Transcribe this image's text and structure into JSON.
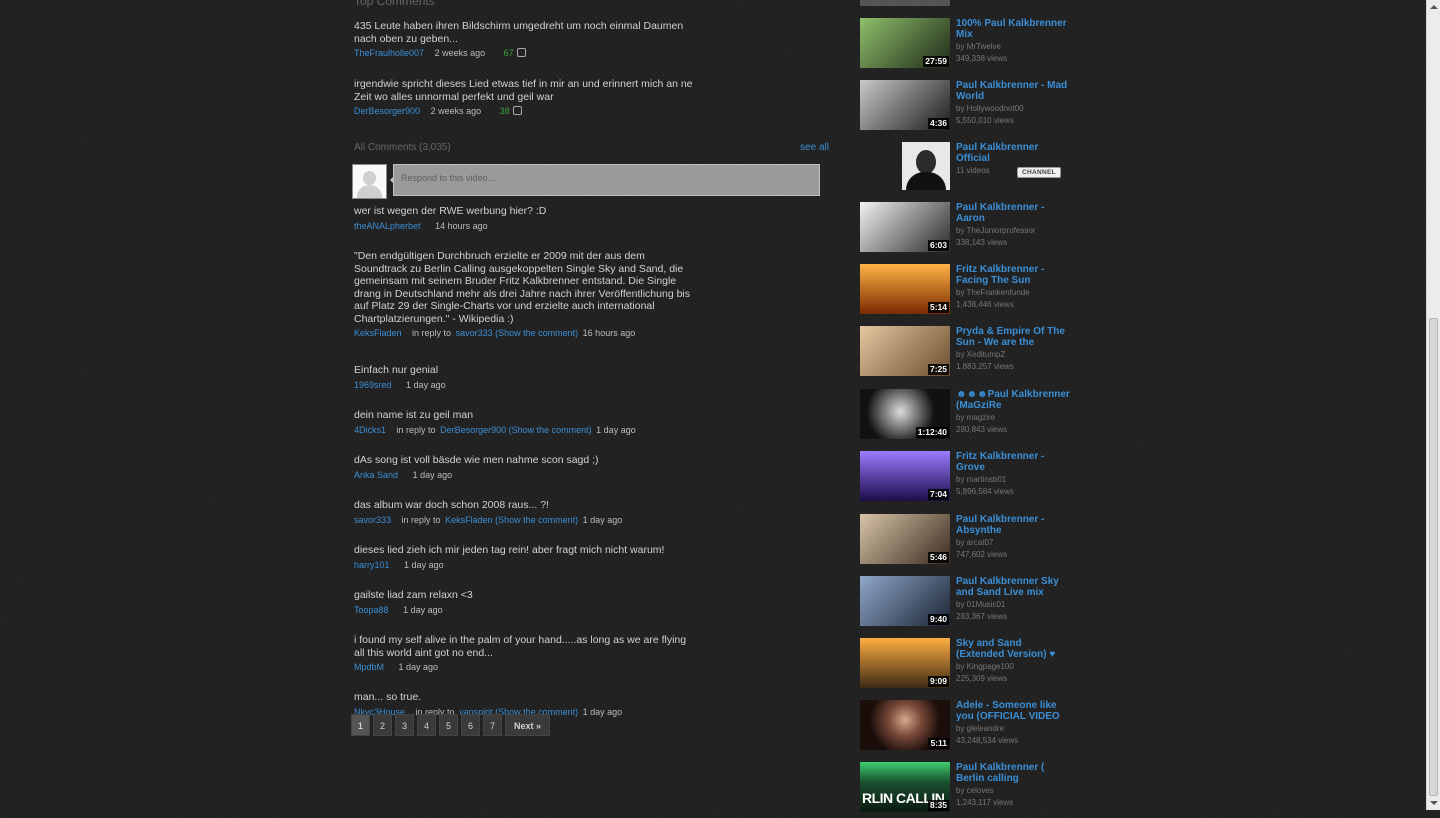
{
  "comments": {
    "top_title": "Top Comments",
    "top": [
      {
        "text": "435 Leute haben ihren Bildschirm umgedreht um noch einmal Daumen nach oben zu geben...",
        "user": "TheFraulholle007",
        "time": "2 weeks ago",
        "likes": "67"
      },
      {
        "text": "irgendwie spricht dieses Lied etwas tief in mir an und erinnert mich an ne Zeit wo alles unnormal perfekt und geil war",
        "user": "DerBesorger900",
        "time": "2 weeks ago",
        "likes": "38"
      }
    ],
    "all_title": "All Comments (3,035)",
    "see_all": "see all",
    "reply_placeholder": "Respond to this video...",
    "list": [
      {
        "text": "wer ist wegen der RWE werbung hier? :D",
        "user": "theANALpherbet",
        "reply_text": "",
        "reply_link": "",
        "time": "14 hours ago"
      },
      {
        "text": "\"Den endgültigen Durchbruch erzielte er 2009 mit der aus dem Soundtrack zu Berlin Calling ausgekoppelten Single Sky and Sand, die gemeinsam mit seinem Bruder Fritz Kalkbrenner entstand. Die Single drang in Deutschland mehr als drei Jahre nach ihrer Veröffentlichung bis auf Platz 29 der Single-Charts vor und erzielte auch international Chartplatzierungen.\" - Wikipedia :)",
        "user": "KeksFladen",
        "reply_text": "in reply to",
        "reply_link": "savor333 (Show the comment)",
        "time": "16 hours ago"
      },
      {
        "text": "Einfach nur genial",
        "user": "1969sred",
        "reply_text": "",
        "reply_link": "",
        "time": "1 day ago"
      },
      {
        "text": "dein name ist zu geil man",
        "user": "4Dicks1",
        "reply_text": "in reply to",
        "reply_link": "DerBesorger900 (Show the comment)",
        "time": "1 day ago"
      },
      {
        "text": "dAs song ist voll bäsde wie men nahme scon sagd ;)",
        "user": "Anka Sand",
        "reply_text": "",
        "reply_link": "",
        "time": "1 day ago"
      },
      {
        "text": "das album war doch schon 2008 raus... ?!",
        "user": "savor333",
        "reply_text": "in reply to",
        "reply_link": "KeksFladen (Show the comment)",
        "time": "1 day ago"
      },
      {
        "text": "dieses lied zieh ich mir jeden tag rein! aber fragt mich nicht warum!",
        "user": "harry101",
        "reply_text": "",
        "reply_link": "",
        "time": "1 day ago"
      },
      {
        "text": "gailste liad zam relaxn <3",
        "user": "Toopa88",
        "reply_text": "",
        "reply_link": "",
        "time": "1 day ago"
      },
      {
        "text": "i found my self alive in the palm of your hand.....as long as we are flying all this world aint got no end...",
        "user": "MpdbM",
        "reply_text": "",
        "reply_link": "",
        "time": "1 day ago"
      },
      {
        "text": "man... so true.",
        "user": "Nkyc3House",
        "reply_text": "in reply to",
        "reply_link": "vanspirit (Show the comment)",
        "time": "1 day ago"
      }
    ]
  },
  "pagination": {
    "pages": [
      "1",
      "2",
      "3",
      "4",
      "5",
      "6",
      "7"
    ],
    "current": "1",
    "next": "Next »"
  },
  "related": [
    {
      "title": "100% Paul Kalkbrenner Mix",
      "by": "by MrTwelve",
      "views": "349,338 views",
      "duration": "27:59",
      "thumb_colors": [
        "#8fbf6a",
        "#1e2a18"
      ]
    },
    {
      "title": "Paul Kalkbrenner - Mad World",
      "by": "by Hollywoodnot00",
      "views": "5,550,010 views",
      "duration": "4:36",
      "thumb_colors": [
        "#c9c9c9",
        "#1b1b1b"
      ]
    },
    {
      "title": "Paul Kalkbrenner Official",
      "by": "",
      "views": "11 videos",
      "duration": "",
      "channel": "CHANNEL",
      "thumb_colors": [
        "#e8e8e8",
        "#222222"
      ]
    },
    {
      "title": "Paul Kalkbrenner - Aaron",
      "by": "by TheJuniorprofessor",
      "views": "338,143 views",
      "duration": "6:03",
      "thumb_colors": [
        "#f2f2f2",
        "#2a2a2a"
      ]
    },
    {
      "title": "Fritz Kalkbrenner - Facing The Sun",
      "by": "by TheFrankenfunde",
      "views": "1,438,446 views",
      "duration": "5:14",
      "thumb_colors": [
        "#ffb347",
        "#7a2a00"
      ]
    },
    {
      "title": "Pryda & Empire Of The Sun - We are the",
      "by": "by XeditumpZ",
      "views": "1,883,257 views",
      "duration": "7:25",
      "thumb_colors": [
        "#e4c7a0",
        "#6b4d2e"
      ]
    },
    {
      "title": "☻☻☻Paul Kalkbrenner (MaGziRe",
      "by": "by magzire",
      "views": "280,843 views",
      "duration": "1:12:40",
      "thumb_colors": [
        "#dddddd",
        "#111111"
      ]
    },
    {
      "title": "Fritz Kalkbrenner - Grove",
      "by": "by martinsb01",
      "views": "5,896,584 views",
      "duration": "7:04",
      "thumb_colors": [
        "#9b7bff",
        "#1c0d4a"
      ]
    },
    {
      "title": "Paul Kalkbrenner - Absynthe",
      "by": "by arcat07",
      "views": "747,602 views",
      "duration": "5:46",
      "thumb_colors": [
        "#d8c4a8",
        "#3b2c20"
      ]
    },
    {
      "title": "Paul Kalkbrenner Sky and Sand Live mix",
      "by": "by 01Music01",
      "views": "283,367 views",
      "duration": "9:40",
      "thumb_colors": [
        "#8fa7c9",
        "#1b2433"
      ]
    },
    {
      "title": "Sky and Sand (Extended Version) ♥",
      "by": "by Kingpage100",
      "views": "225,309 views",
      "duration": "9:09",
      "thumb_colors": [
        "#ffae42",
        "#3d2a14"
      ]
    },
    {
      "title": "Adele - Someone like you (OFFICIAL VIDEO",
      "by": "by gleleandre",
      "views": "43,248,534 views",
      "duration": "5:11",
      "thumb_colors": [
        "#d6a88a",
        "#1a0d0a"
      ]
    },
    {
      "title": "Paul Kalkbrenner ( Berlin calling",
      "by": "by celoves",
      "views": "1,243,117 views",
      "duration": "8:35",
      "thumb_text": "RLIN CALLIN",
      "thumb_colors": [
        "#3fd070",
        "#0b1a10"
      ]
    }
  ]
}
